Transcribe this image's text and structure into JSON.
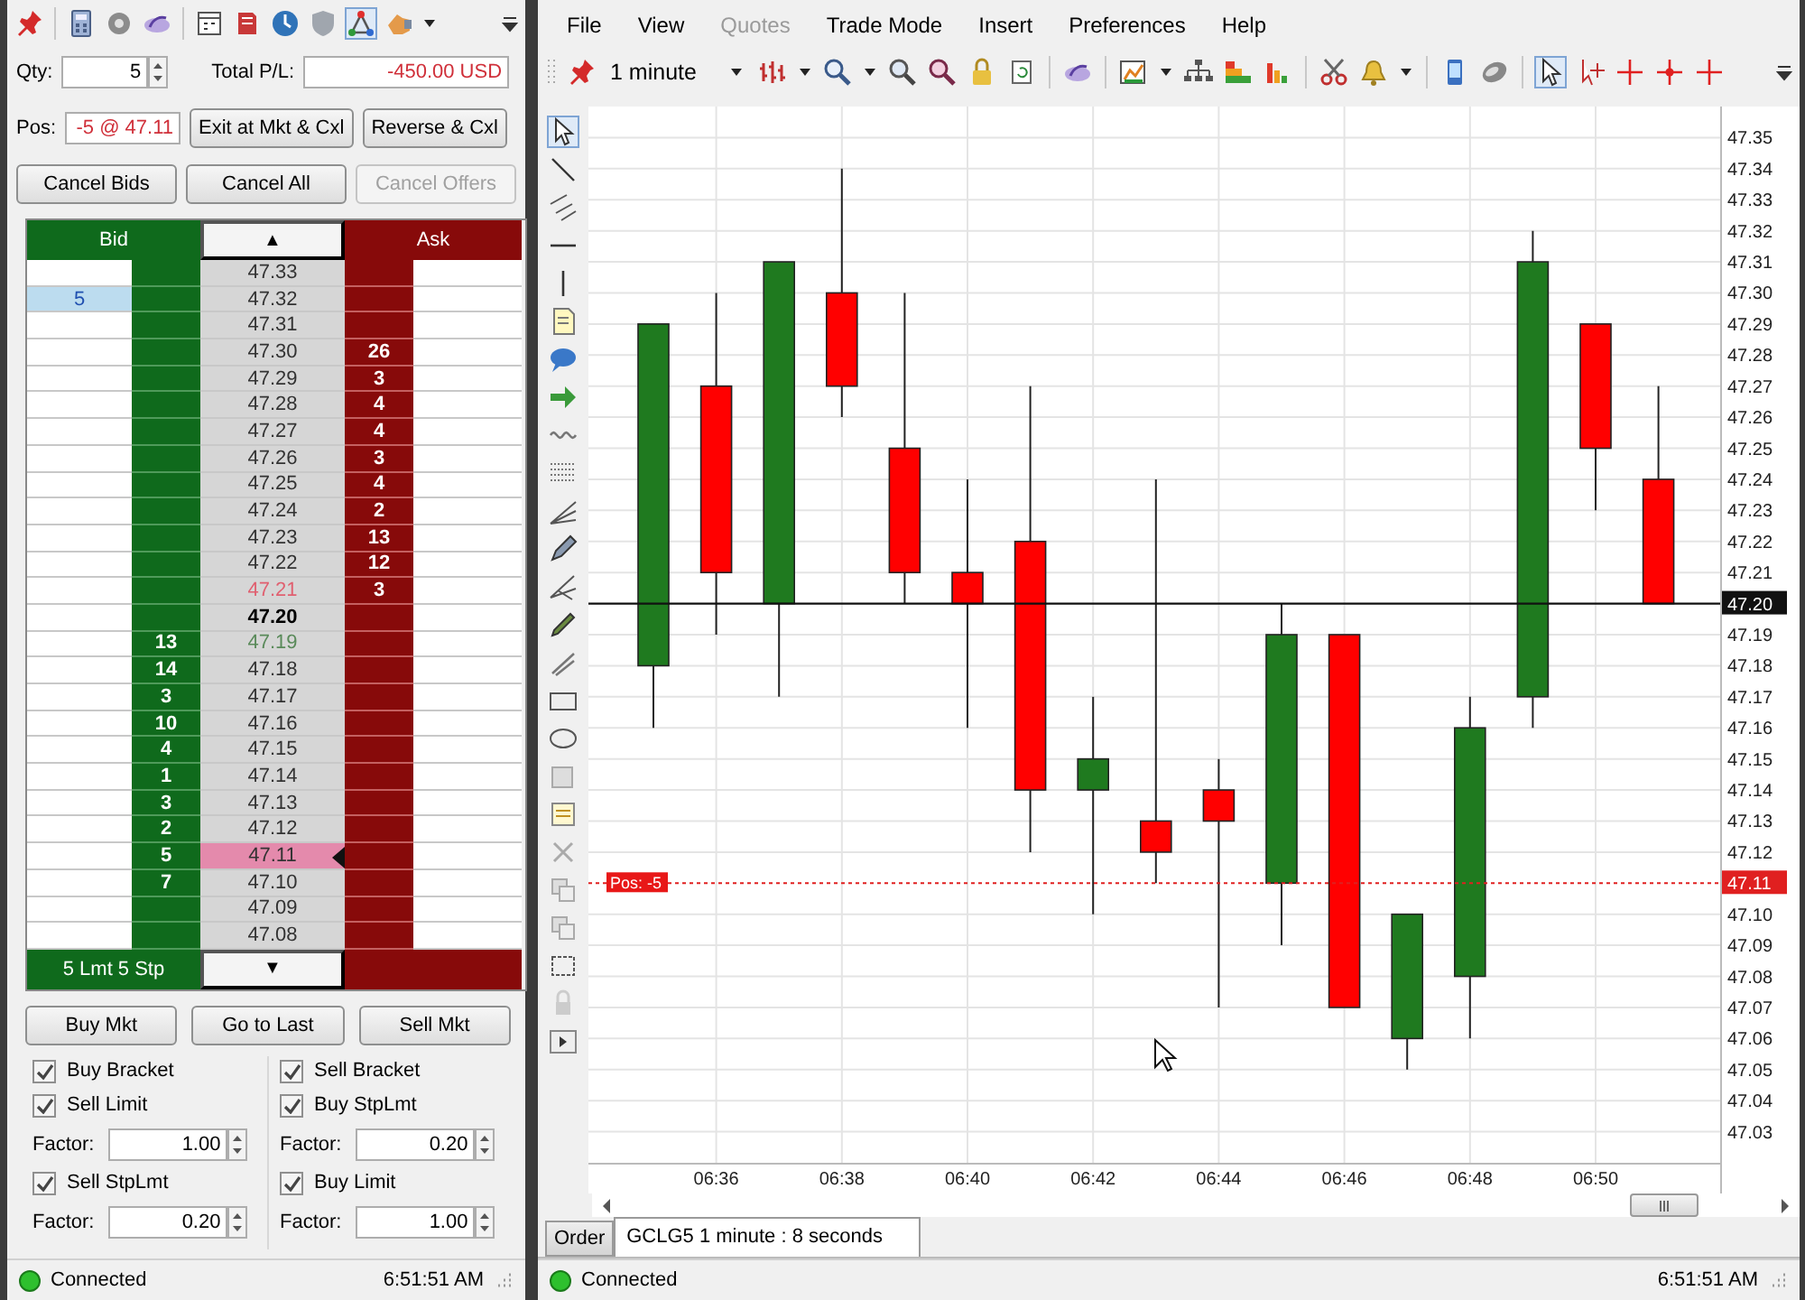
{
  "order_panel": {
    "qty": {
      "label": "Qty:",
      "value": "5"
    },
    "total_pl": {
      "label": "Total P/L:",
      "value": "-450.00 USD"
    },
    "position": {
      "label": "Pos:",
      "value": "-5 @ 47.11"
    },
    "action_buttons": [
      {
        "label": "Exit at Mkt & Cxl",
        "disabled": false
      },
      {
        "label": "Reverse & Cxl",
        "disabled": false
      }
    ],
    "cancel_buttons": [
      {
        "label": "Cancel Bids",
        "disabled": false
      },
      {
        "label": "Cancel All",
        "disabled": false
      },
      {
        "label": "Cancel Offers",
        "disabled": true
      }
    ],
    "ladder": {
      "header": {
        "bid": "Bid",
        "up": "▲",
        "ask": "Ask"
      },
      "rows": [
        {
          "price": "47.33",
          "kind": "plain"
        },
        {
          "price": "47.32",
          "kind": "plain",
          "bid_order": "5"
        },
        {
          "price": "47.31",
          "kind": "plain"
        },
        {
          "price": "47.30",
          "kind": "plain",
          "ask": "26"
        },
        {
          "price": "47.29",
          "kind": "plain",
          "ask": "3"
        },
        {
          "price": "47.28",
          "kind": "plain",
          "ask": "4"
        },
        {
          "price": "47.27",
          "kind": "plain",
          "ask": "4"
        },
        {
          "price": "47.26",
          "kind": "plain",
          "ask": "3"
        },
        {
          "price": "47.25",
          "kind": "plain",
          "ask": "4"
        },
        {
          "price": "47.24",
          "kind": "plain",
          "ask": "2"
        },
        {
          "price": "47.23",
          "kind": "plain",
          "ask": "13"
        },
        {
          "price": "47.22",
          "kind": "plain",
          "ask": "12"
        },
        {
          "price": "47.21",
          "kind": "best_ask",
          "ask": "3"
        },
        {
          "price": "47.20",
          "kind": "last"
        },
        {
          "price": "47.19",
          "kind": "best_bid",
          "bid": "13"
        },
        {
          "price": "47.18",
          "kind": "plain",
          "bid": "14"
        },
        {
          "price": "47.17",
          "kind": "plain",
          "bid": "3"
        },
        {
          "price": "47.16",
          "kind": "plain",
          "bid": "10"
        },
        {
          "price": "47.15",
          "kind": "plain",
          "bid": "4"
        },
        {
          "price": "47.14",
          "kind": "plain",
          "bid": "1"
        },
        {
          "price": "47.13",
          "kind": "plain",
          "bid": "3"
        },
        {
          "price": "47.12",
          "kind": "plain",
          "bid": "2"
        },
        {
          "price": "47.11",
          "kind": "position",
          "bid": "5"
        },
        {
          "price": "47.10",
          "kind": "plain",
          "bid": "7"
        },
        {
          "price": "47.09",
          "kind": "plain"
        },
        {
          "price": "47.08",
          "kind": "plain"
        }
      ],
      "footer": {
        "orders": "5 Lmt 5 Stp",
        "down": "▼"
      }
    },
    "trade_buttons": [
      "Buy Mkt",
      "Go to Last",
      "Sell Mkt"
    ],
    "brackets": [
      [
        {
          "kind": "checkbox",
          "label": "Buy Bracket",
          "checked": true
        },
        {
          "kind": "checkbox",
          "label": "Sell Limit",
          "checked": true
        },
        {
          "kind": "factor",
          "label": "Factor:",
          "value": "1.00"
        },
        {
          "kind": "checkbox",
          "label": "Sell StpLmt",
          "checked": true
        },
        {
          "kind": "factor",
          "label": "Factor:",
          "value": "0.20"
        }
      ],
      [
        {
          "kind": "checkbox",
          "label": "Sell Bracket",
          "checked": true
        },
        {
          "kind": "checkbox",
          "label": "Buy StpLmt",
          "checked": true
        },
        {
          "kind": "factor",
          "label": "Factor:",
          "value": "0.20"
        },
        {
          "kind": "checkbox",
          "label": "Buy Limit",
          "checked": true
        },
        {
          "kind": "factor",
          "label": "Factor:",
          "value": "1.00"
        }
      ]
    ],
    "status": {
      "connection": "Connected",
      "connected": true,
      "time": "6:51:51 AM"
    }
  },
  "chart_window": {
    "menu": [
      {
        "label": "File",
        "disabled": false
      },
      {
        "label": "View",
        "disabled": false
      },
      {
        "label": "Quotes",
        "disabled": true
      },
      {
        "label": "Trade Mode",
        "disabled": false
      },
      {
        "label": "Insert",
        "disabled": false
      },
      {
        "label": "Preferences",
        "disabled": false
      },
      {
        "label": "Help",
        "disabled": false
      }
    ],
    "interval": "1 minute",
    "chart_data": {
      "type": "candlestick",
      "categories": [
        null,
        "06:36",
        null,
        "06:38",
        null,
        "06:40",
        null,
        "06:42",
        null,
        "06:44",
        null,
        "06:46",
        null,
        "06:48",
        null,
        "06:50",
        null
      ],
      "ohlc": [
        [
          47.18,
          47.29,
          47.16,
          47.29
        ],
        [
          47.27,
          47.3,
          47.19,
          47.21
        ],
        [
          47.2,
          47.31,
          47.17,
          47.31
        ],
        [
          47.3,
          47.34,
          47.26,
          47.27
        ],
        [
          47.25,
          47.3,
          47.2,
          47.21
        ],
        [
          47.21,
          47.24,
          47.16,
          47.2
        ],
        [
          47.22,
          47.27,
          47.12,
          47.14
        ],
        [
          47.14,
          47.17,
          47.1,
          47.15
        ],
        [
          47.13,
          47.24,
          47.11,
          47.12
        ],
        [
          47.14,
          47.15,
          47.07,
          47.13
        ],
        [
          47.11,
          47.2,
          47.09,
          47.19
        ],
        [
          47.19,
          47.19,
          47.07,
          47.07
        ],
        [
          47.06,
          47.1,
          47.05,
          47.1
        ],
        [
          47.08,
          47.17,
          47.06,
          47.16
        ],
        [
          47.17,
          47.32,
          47.16,
          47.31
        ],
        [
          47.29,
          47.29,
          47.23,
          47.25
        ],
        [
          47.24,
          47.27,
          47.2,
          47.2
        ]
      ],
      "ylim": [
        47.02,
        47.36
      ],
      "yticks": [
        {
          "value": 47.03,
          "label": "47.03"
        },
        {
          "value": 47.04,
          "label": "47.04"
        },
        {
          "value": 47.05,
          "label": "47.05"
        },
        {
          "value": 47.06,
          "label": "47.06"
        },
        {
          "value": 47.07,
          "label": "47.07"
        },
        {
          "value": 47.08,
          "label": "47.08"
        },
        {
          "value": 47.09,
          "label": "47.09"
        },
        {
          "value": 47.1,
          "label": "47.10"
        },
        {
          "value": 47.12,
          "label": "47.12"
        },
        {
          "value": 47.13,
          "label": "47.13"
        },
        {
          "value": 47.14,
          "label": "47.14"
        },
        {
          "value": 47.15,
          "label": "47.15"
        },
        {
          "value": 47.16,
          "label": "47.16"
        },
        {
          "value": 47.17,
          "label": "47.17"
        },
        {
          "value": 47.18,
          "label": "47.18"
        },
        {
          "value": 47.19,
          "label": "47.19"
        },
        {
          "value": 47.21,
          "label": "47.21"
        },
        {
          "value": 47.22,
          "label": "47.22"
        },
        {
          "value": 47.23,
          "label": "47.23"
        },
        {
          "value": 47.24,
          "label": "47.24"
        },
        {
          "value": 47.25,
          "label": "47.25"
        },
        {
          "value": 47.26,
          "label": "47.26"
        },
        {
          "value": 47.27,
          "label": "47.27"
        },
        {
          "value": 47.28,
          "label": "47.28"
        },
        {
          "value": 47.29,
          "label": "47.29"
        },
        {
          "value": 47.3,
          "label": "47.30"
        },
        {
          "value": 47.31,
          "label": "47.31"
        },
        {
          "value": 47.32,
          "label": "47.32"
        },
        {
          "value": 47.33,
          "label": "47.33"
        },
        {
          "value": 47.34,
          "label": "47.34"
        },
        {
          "value": 47.35,
          "label": "47.35"
        }
      ],
      "grid": true,
      "ref_lines": [
        {
          "axis": "y",
          "value": 47.2,
          "label": "47.20",
          "color": "#111111"
        },
        {
          "axis": "y",
          "value": 47.11,
          "label": "47.11",
          "color": "#e02020"
        }
      ],
      "annotations": [
        "Pos: -5"
      ]
    },
    "tabs": [
      {
        "label": "Order",
        "selected": false
      },
      {
        "label": "GCLG5 1 minute : 8 seconds",
        "selected": true
      }
    ],
    "status": {
      "connection": "Connected",
      "connected": true,
      "time": "6:51:51 AM"
    }
  }
}
